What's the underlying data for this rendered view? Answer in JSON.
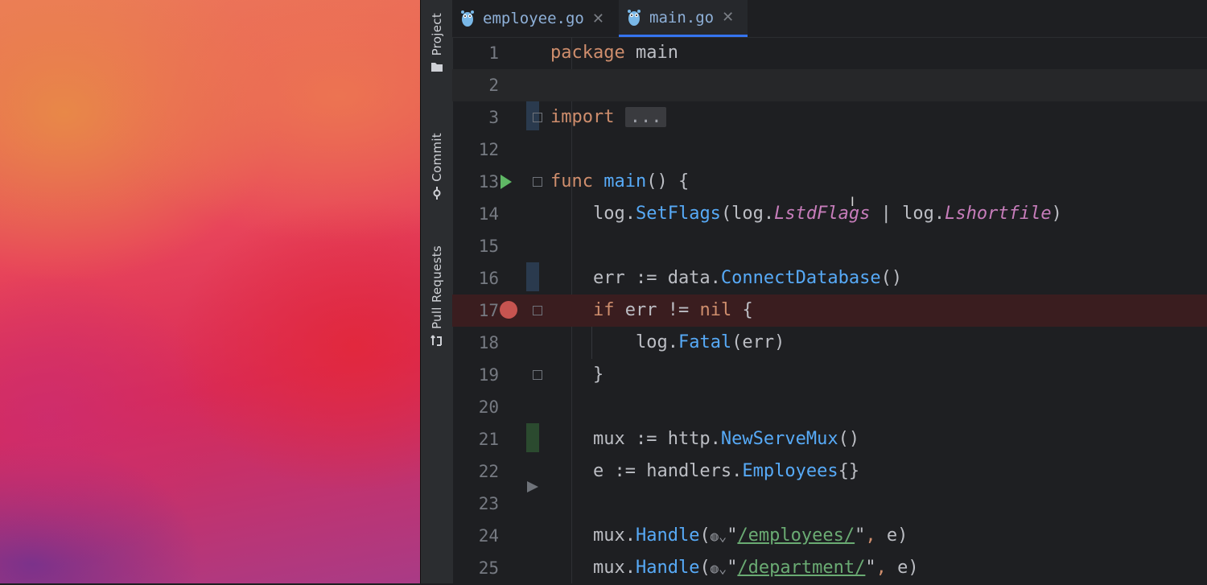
{
  "left_tools": [
    {
      "label": "Project",
      "icon": "folder-icon"
    },
    {
      "label": "Commit",
      "icon": "commit-icon"
    },
    {
      "label": "Pull Requests",
      "icon": "pull-request-icon"
    }
  ],
  "tabs": [
    {
      "label": "employee.go",
      "active": false
    },
    {
      "label": "main.go",
      "active": true
    }
  ],
  "lines": [
    {
      "num": "1",
      "parts": [
        [
          "kw",
          "package"
        ],
        [
          "",
          ""
        ],
        [
          "ident",
          " main"
        ]
      ]
    },
    {
      "num": "2",
      "parts": []
    },
    {
      "num": "3",
      "parts": [
        [
          "kw",
          "import"
        ],
        [
          "ident",
          " "
        ],
        [
          "fold",
          "..."
        ]
      ]
    },
    {
      "num": "12",
      "parts": []
    },
    {
      "num": "13",
      "parts": [
        [
          "kw",
          "func"
        ],
        [
          "ident",
          " "
        ],
        [
          "call",
          "main"
        ],
        [
          "ident",
          "() {"
        ]
      ]
    },
    {
      "num": "14",
      "parts": [
        [
          "ident",
          "    log."
        ],
        [
          "call",
          "SetFlags"
        ],
        [
          "ident",
          "(log."
        ],
        [
          "const",
          "LstdFlags"
        ],
        [
          "ident",
          " | log."
        ],
        [
          "const",
          "Lshortfile"
        ],
        [
          "ident",
          ")"
        ]
      ]
    },
    {
      "num": "15",
      "parts": []
    },
    {
      "num": "16",
      "parts": [
        [
          "ident",
          "    err := data."
        ],
        [
          "call",
          "ConnectDatabase"
        ],
        [
          "ident",
          "()"
        ]
      ]
    },
    {
      "num": "17",
      "parts": [
        [
          "kw",
          "    if"
        ],
        [
          "ident",
          " err != "
        ],
        [
          "kw",
          "nil"
        ],
        [
          "ident",
          " {"
        ]
      ]
    },
    {
      "num": "18",
      "parts": [
        [
          "ident",
          "        log."
        ],
        [
          "call",
          "Fatal"
        ],
        [
          "ident",
          "(err)"
        ]
      ]
    },
    {
      "num": "19",
      "parts": [
        [
          "ident",
          "    }"
        ]
      ]
    },
    {
      "num": "20",
      "parts": []
    },
    {
      "num": "21",
      "parts": [
        [
          "ident",
          "    mux := http."
        ],
        [
          "call",
          "NewServeMux"
        ],
        [
          "ident",
          "()"
        ]
      ]
    },
    {
      "num": "22",
      "parts": [
        [
          "ident",
          "    e := handlers."
        ],
        [
          "call",
          "Employees"
        ],
        [
          "ident",
          "{}"
        ]
      ]
    },
    {
      "num": "23",
      "parts": []
    },
    {
      "num": "24",
      "parts": [
        [
          "ident",
          "    mux."
        ],
        [
          "call",
          "Handle"
        ],
        [
          "ident",
          "("
        ],
        [
          "globe",
          "◍⌄"
        ],
        [
          "ident",
          "\""
        ],
        [
          "str",
          "/employees/"
        ],
        [
          "ident",
          "\""
        ],
        [
          "kw",
          ","
        ],
        [
          "ident",
          " e)"
        ]
      ]
    },
    {
      "num": "25",
      "parts": [
        [
          "ident",
          "    mux."
        ],
        [
          "call",
          "Handle"
        ],
        [
          "ident",
          "("
        ],
        [
          "globe",
          "◍⌄"
        ],
        [
          "ident",
          "\""
        ],
        [
          "str",
          "/department/"
        ],
        [
          "ident",
          "\""
        ],
        [
          "kw",
          ","
        ],
        [
          "ident",
          " e)"
        ]
      ]
    }
  ],
  "colors": {
    "accent": "#3574f0",
    "run": "#5fb865",
    "breakpoint": "#c75450"
  }
}
